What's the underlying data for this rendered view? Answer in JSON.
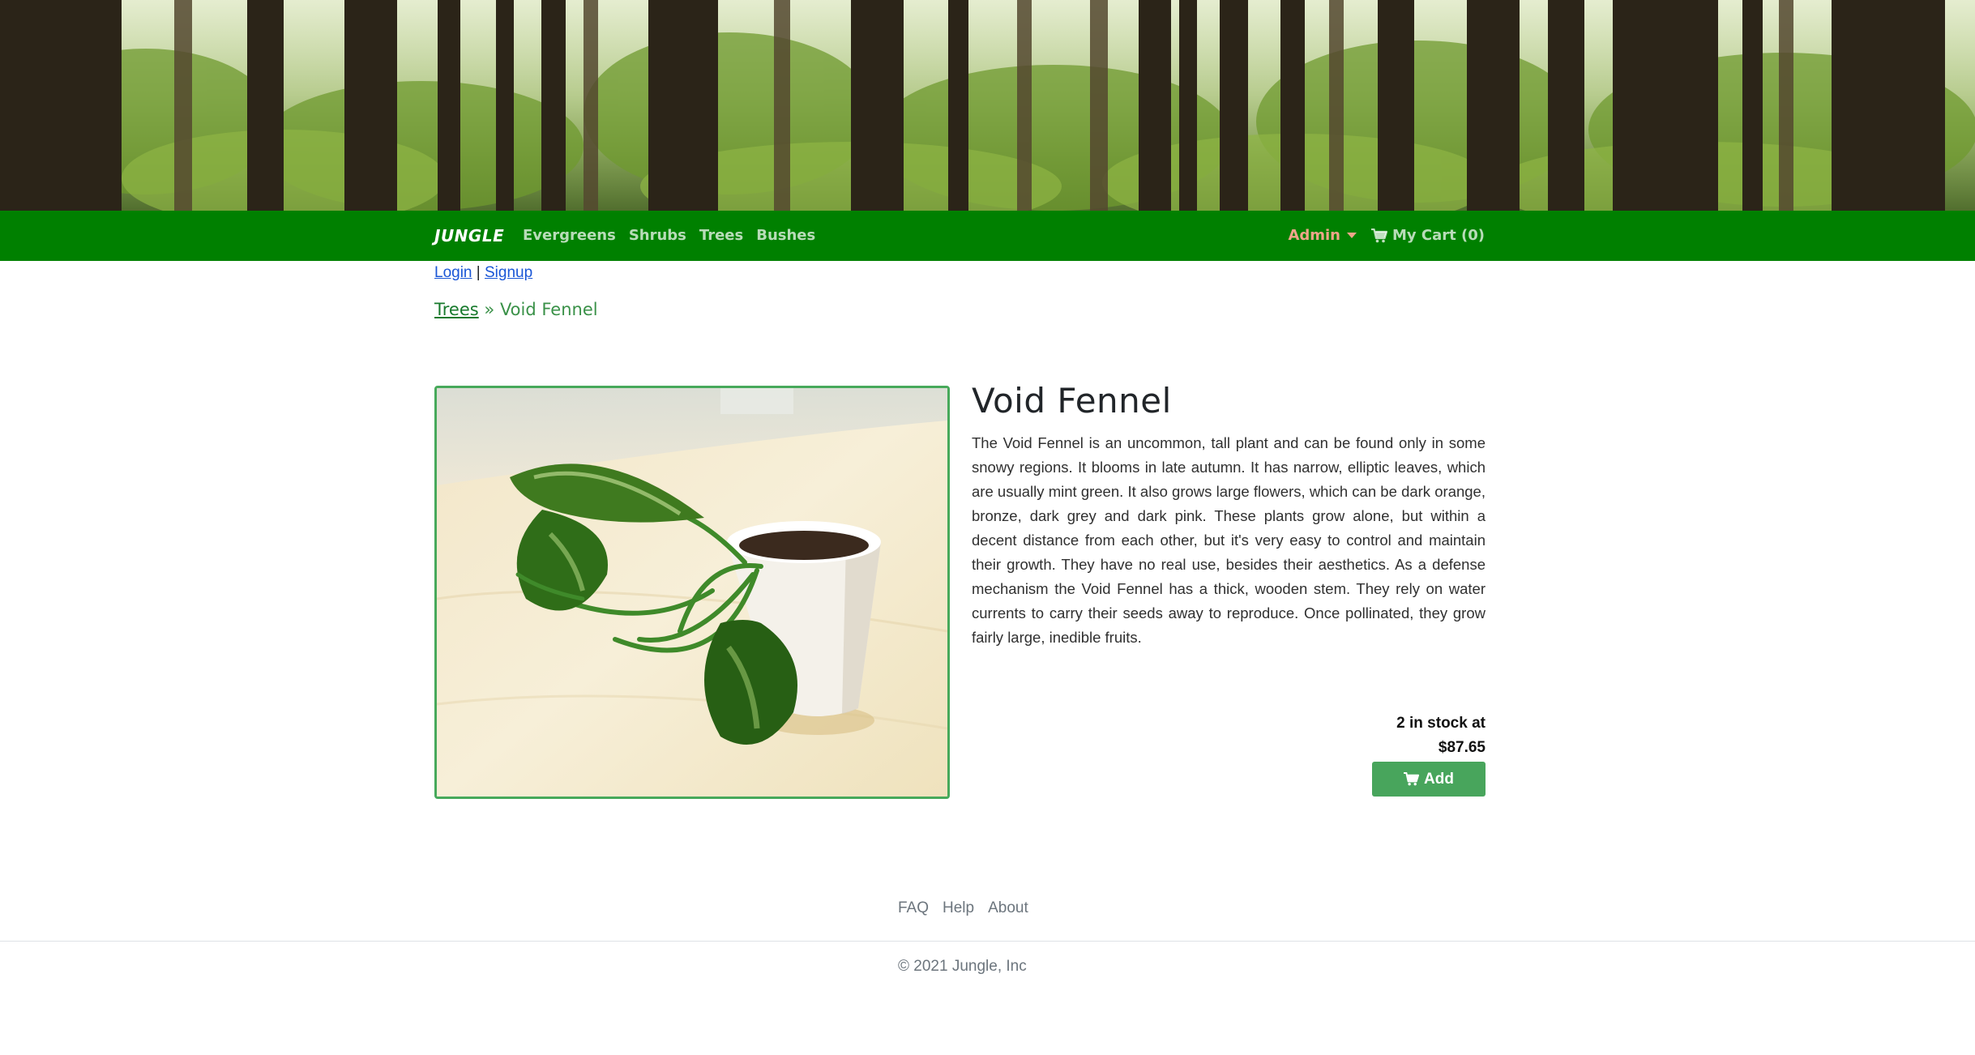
{
  "nav": {
    "brand": "JUNGLE",
    "links": [
      "Evergreens",
      "Shrubs",
      "Trees",
      "Bushes"
    ],
    "admin_label": "Admin",
    "cart_label": "My Cart (0)"
  },
  "auth": {
    "login": "Login",
    "separator": "|",
    "signup": "Signup"
  },
  "breadcrumb": {
    "category": "Trees",
    "separator": "»",
    "current": "Void Fennel"
  },
  "product": {
    "name": "Void Fennel",
    "description": "The Void Fennel is an uncommon, tall plant and can be found only in some snowy regions. It blooms in late autumn. It has narrow, elliptic leaves, which are usually mint green. It also grows large flowers, which can be dark orange, bronze, dark grey and dark pink. These plants grow alone, but within a decent distance from each other, but it's very easy to control and maintain their growth. They have no real use, besides their aesthetics. As a defense mechanism the Void Fennel has a thick, wooden stem. They rely on water currents to carry their seeds away to reproduce. Once pollinated, they grow fairly large, inedible fruits.",
    "stock_text": "2 in stock at",
    "price": "$87.65",
    "add_label": "Add"
  },
  "footer": {
    "links": [
      "FAQ",
      "Help",
      "About"
    ],
    "copyright": "© 2021 Jungle, Inc"
  },
  "colors": {
    "nav_bg": "#008000",
    "accent_green": "#48a55c",
    "admin_color": "#f0a58a",
    "link_blue": "#1a56d6"
  },
  "icons": {
    "cart": "shopping-cart-icon",
    "caret": "caret-down-icon"
  }
}
